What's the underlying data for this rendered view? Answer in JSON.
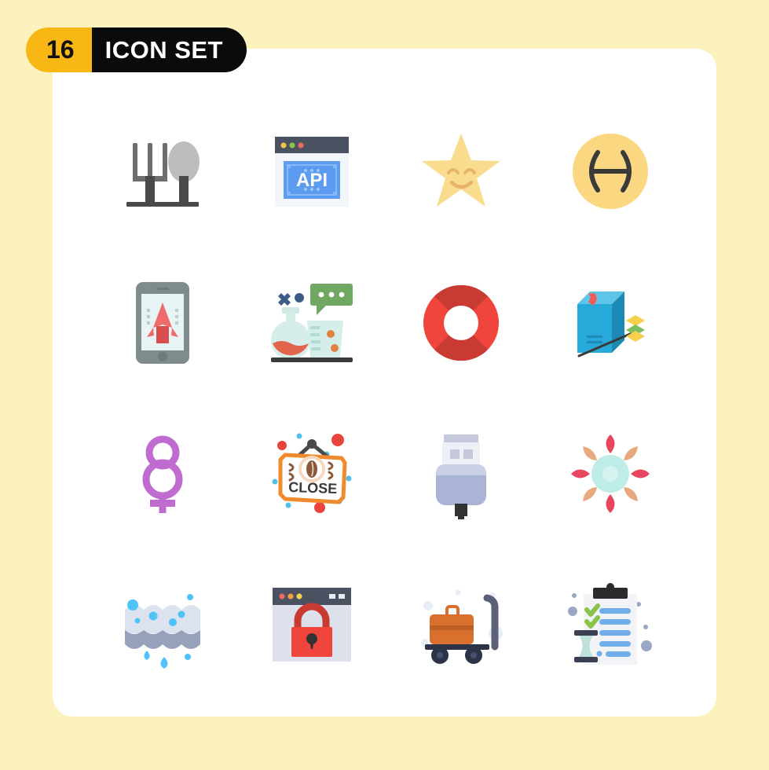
{
  "page": {
    "background_color": "#FBF2BE",
    "card_color": "#FFFFFF"
  },
  "badge": {
    "count": "16",
    "label": "ICON SET",
    "count_bg": "#F8B714",
    "label_bg": "#0B0B0B",
    "count_text_color": "#111111",
    "label_text_color": "#FFFFFF"
  },
  "icons": [
    {
      "id": "cutlery",
      "name": "fork-and-spoon-icon",
      "label": "Fork and spoon",
      "colors": [
        "#6E6E6E",
        "#4A4A4A",
        "#BDBDBD"
      ]
    },
    {
      "id": "api",
      "name": "api-window-icon",
      "label": "API browser window",
      "text": "API",
      "colors": [
        "#4A5160",
        "#F2F5FA",
        "#5B9BF0",
        "#FFFFFF"
      ]
    },
    {
      "id": "star-smile",
      "name": "smiling-star-icon",
      "label": "Smiling star",
      "colors": [
        "#F9DC8E",
        "#E8B36A"
      ]
    },
    {
      "id": "pisces",
      "name": "pisces-zodiac-icon",
      "label": "Pisces zodiac",
      "colors": [
        "#FBD782",
        "#3A3A3A"
      ]
    },
    {
      "id": "mobile-app",
      "name": "mobile-rocket-icon",
      "label": "Mobile app rocket",
      "colors": [
        "#7E8C8D",
        "#E8F4F3",
        "#EF6A6A",
        "#D94F4F"
      ]
    },
    {
      "id": "chemistry",
      "name": "chemistry-lab-icon",
      "label": "Chemistry lab chat",
      "colors": [
        "#D6EEEA",
        "#E2644A",
        "#6FA763",
        "#3B5C86"
      ]
    },
    {
      "id": "lifebuoy",
      "name": "lifebuoy-icon",
      "label": "Lifebuoy",
      "colors": [
        "#F0453D",
        "#C93A33"
      ]
    },
    {
      "id": "package-box",
      "name": "package-box-icon",
      "label": "Package box layers",
      "colors": [
        "#27A9D9",
        "#1C8AB5",
        "#F25C54",
        "#F6D04D",
        "#7DBF5C"
      ]
    },
    {
      "id": "female-symbol",
      "name": "female-symbol-icon",
      "label": "Female gender symbol",
      "colors": [
        "#C06BD0",
        "#A855BC"
      ]
    },
    {
      "id": "close-sign",
      "name": "close-sign-icon",
      "label": "Close sign",
      "text": "CLOSE",
      "colors": [
        "#F08A2E",
        "#4A4A4A",
        "#8A5A3B",
        "#E8443C",
        "#4FC0E8"
      ]
    },
    {
      "id": "usb-plug",
      "name": "usb-plug-icon",
      "label": "USB plug",
      "colors": [
        "#AAB4D4",
        "#CAD1E6",
        "#E8EBF4",
        "#333333"
      ]
    },
    {
      "id": "flower",
      "name": "flower-mandala-icon",
      "label": "Flower mandala",
      "colors": [
        "#E8455E",
        "#E8A97E",
        "#BDEDE8"
      ]
    },
    {
      "id": "sponge",
      "name": "sponge-icon",
      "label": "Sponge with bubbles",
      "colors": [
        "#DDE2EF",
        "#98A1BC",
        "#4FC3F7"
      ]
    },
    {
      "id": "secure-window",
      "name": "secure-browser-icon",
      "label": "Secure browser lock",
      "colors": [
        "#4A5160",
        "#DDE1EC",
        "#F0453D",
        "#C93A33",
        "#333333"
      ]
    },
    {
      "id": "luggage-cart",
      "name": "luggage-cart-icon",
      "label": "Luggage cart",
      "colors": [
        "#D9702E",
        "#5A6178",
        "#2E3448",
        "#E8EDF5"
      ]
    },
    {
      "id": "checklist",
      "name": "clipboard-checklist-icon",
      "label": "Clipboard checklist",
      "colors": [
        "#F1F3F7",
        "#2B2B2B",
        "#6FAEE8",
        "#8BC34A",
        "#BEE0DB"
      ]
    }
  ]
}
